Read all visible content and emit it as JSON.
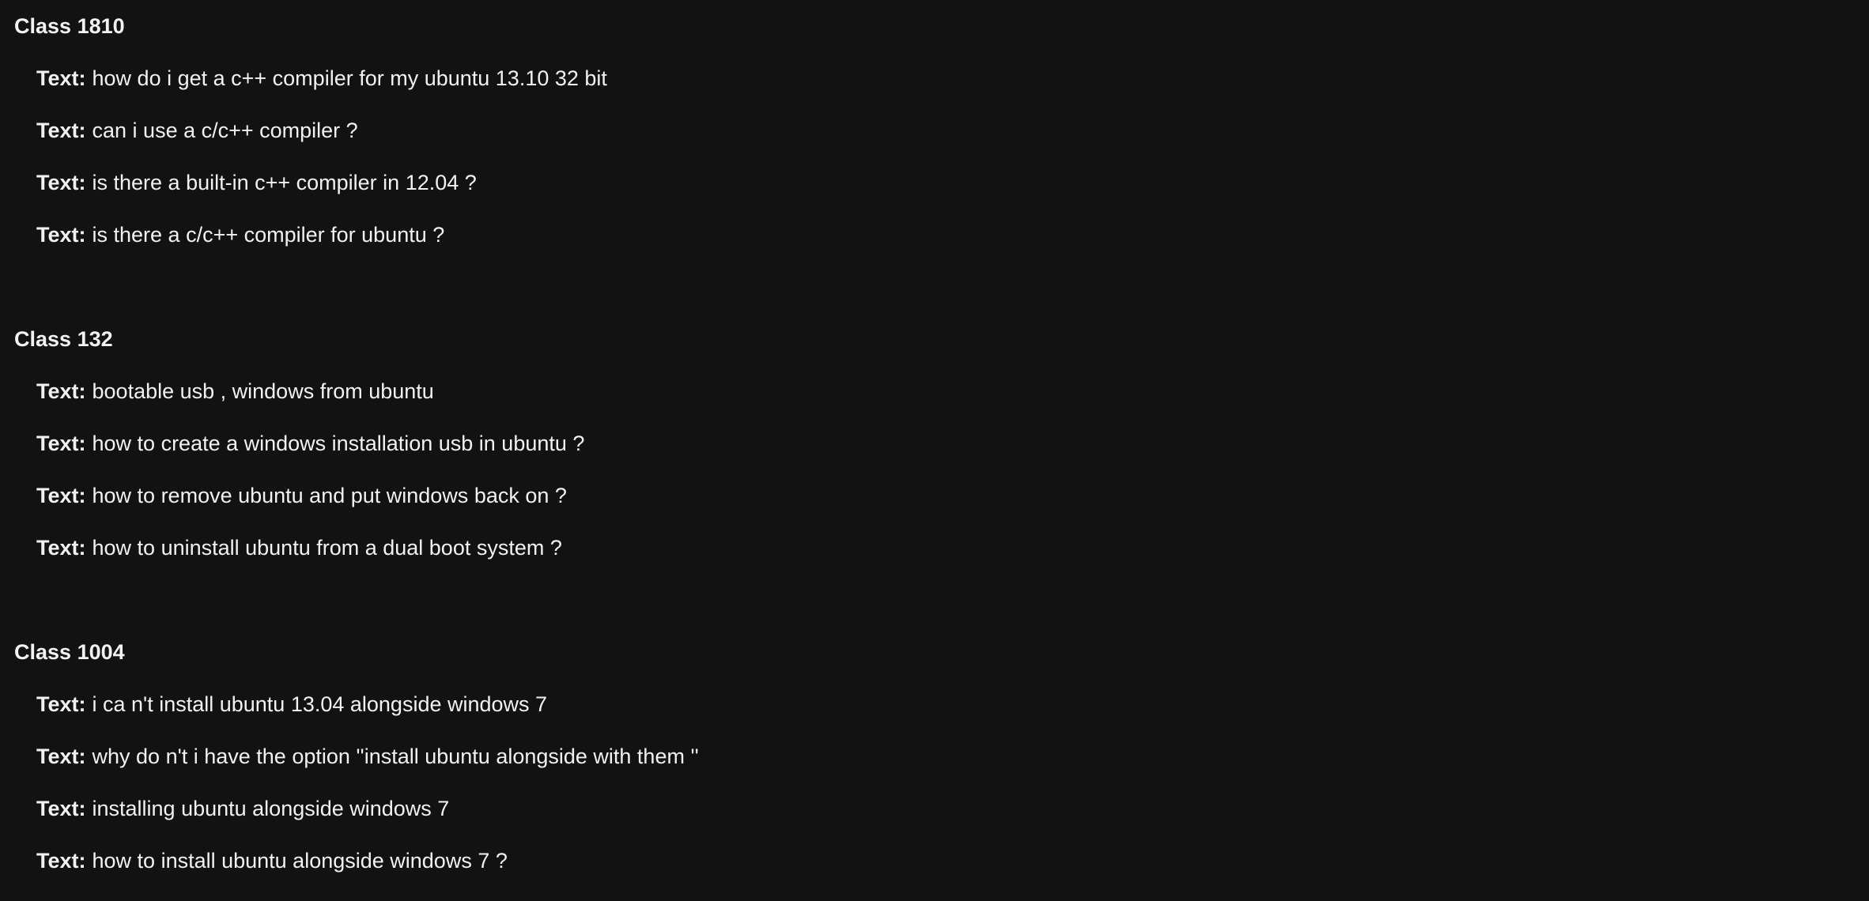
{
  "groups": [
    {
      "class_label": "Class",
      "class_id": "1810",
      "entries": [
        {
          "label": "Text:",
          "value": "how do i get a c++ compiler for my ubuntu 13.10 32 bit"
        },
        {
          "label": "Text:",
          "value": "can i use a c/c++ compiler ?"
        },
        {
          "label": "Text:",
          "value": "is there a built-in c++ compiler in 12.04 ?"
        },
        {
          "label": "Text:",
          "value": "is there a c/c++ compiler for ubuntu ?"
        }
      ]
    },
    {
      "class_label": "Class",
      "class_id": "132",
      "entries": [
        {
          "label": "Text:",
          "value": "bootable usb , windows from ubuntu"
        },
        {
          "label": "Text:",
          "value": "how to create a windows installation usb in ubuntu ?"
        },
        {
          "label": "Text:",
          "value": "how to remove ubuntu and put windows back on ?"
        },
        {
          "label": "Text:",
          "value": "how to uninstall ubuntu from a dual boot system ?"
        }
      ]
    },
    {
      "class_label": "Class",
      "class_id": "1004",
      "entries": [
        {
          "label": "Text:",
          "value": "i ca n't install ubuntu 13.04 alongside windows 7"
        },
        {
          "label": "Text:",
          "value": "why do n't i have the option ''install ubuntu alongside with them ''"
        },
        {
          "label": "Text:",
          "value": "installing ubuntu alongside windows 7"
        },
        {
          "label": "Text:",
          "value": "how to install ubuntu alongside windows 7 ?"
        }
      ]
    }
  ]
}
